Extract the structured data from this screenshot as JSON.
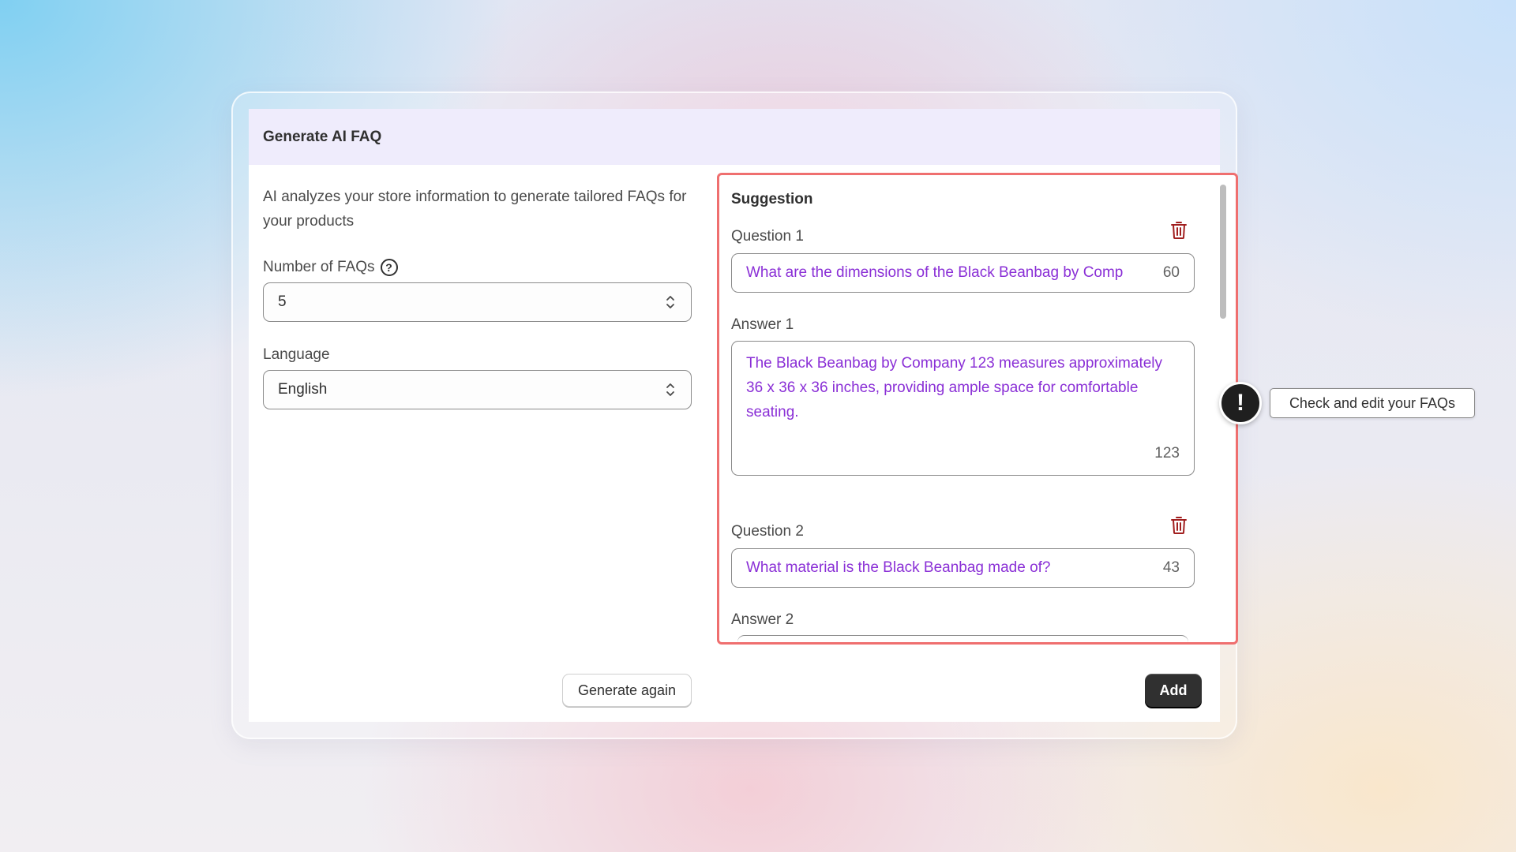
{
  "modal": {
    "title": "Generate AI FAQ",
    "description": "AI analyzes your store information to generate tailored FAQs for your products",
    "num_faqs_label": "Number of FAQs",
    "num_faqs_value": "5",
    "language_label": "Language",
    "language_value": "English",
    "generate_again_label": "Generate again",
    "add_label": "Add"
  },
  "suggestion": {
    "title": "Suggestion",
    "items": [
      {
        "question_label": "Question 1",
        "question": "What are the dimensions of the Black Beanbag by Comp",
        "question_count": "60",
        "answer_label": "Answer 1",
        "answer": "The Black Beanbag by Company 123 measures approximately 36 x 36 x 36 inches, providing ample space for comfortable seating.",
        "answer_count": "123"
      },
      {
        "question_label": "Question 2",
        "question": "What material is the Black Beanbag made of?",
        "question_count": "43",
        "answer_label": "Answer 2"
      }
    ]
  },
  "callout": {
    "icon_symbol": "!",
    "text": "Check and edit your FAQs"
  },
  "colors": {
    "header_bg": "#efecfc",
    "accent_text": "#8a2fd6",
    "highlight_border": "#ef6f6f",
    "delete_icon": "#a11f1f",
    "primary_button": "#303030"
  }
}
